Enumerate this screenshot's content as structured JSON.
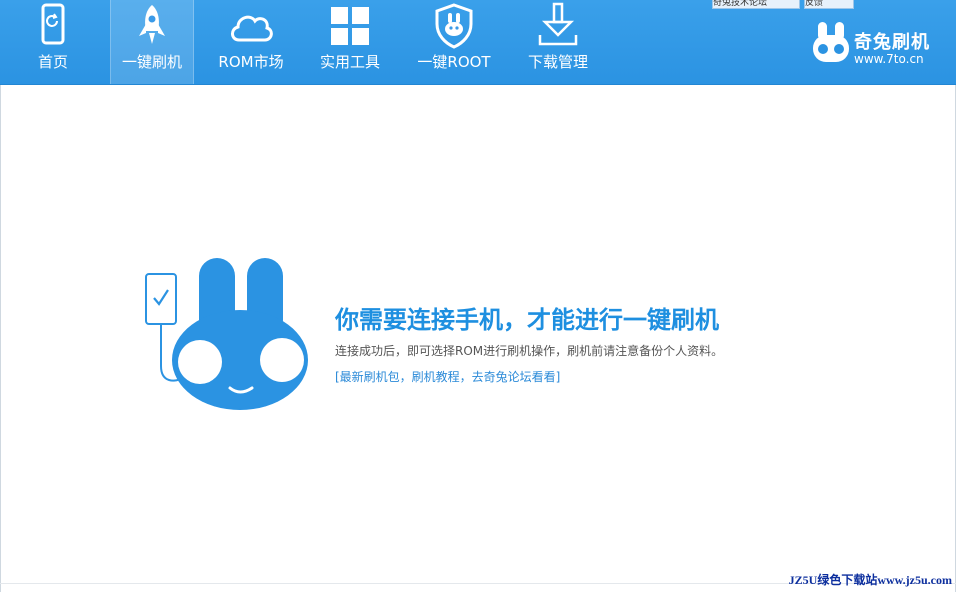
{
  "nav": {
    "items": [
      {
        "label": "首页",
        "icon": "phone-refresh-icon"
      },
      {
        "label": "一键刷机",
        "icon": "rocket-icon"
      },
      {
        "label": "ROM市场",
        "icon": "cloud-icon"
      },
      {
        "label": "实用工具",
        "icon": "grid-icon"
      },
      {
        "label": "一键ROOT",
        "icon": "shield-rabbit-icon"
      },
      {
        "label": "下载管理",
        "icon": "download-icon"
      }
    ],
    "active_index": 1
  },
  "top_strip": {
    "left_label": "奇兔技术论坛",
    "right_label": "反馈"
  },
  "brand": {
    "name": "奇兔刷机",
    "url": "www.7to.cn"
  },
  "main": {
    "headline": "你需要连接手机，才能进行一键刷机",
    "subline": "连接成功后，即可选择ROM进行刷机操作，刷机前请注意备份个人资料。",
    "link": "[最新刷机包，刷机教程，去奇兔论坛看看]"
  },
  "watermark": "JZ5U绿色下载站www.jz5u.com",
  "colors": {
    "header_blue": "#2b93e2",
    "accent_blue": "#1e8fe0",
    "link_blue": "#2b8ad8"
  }
}
